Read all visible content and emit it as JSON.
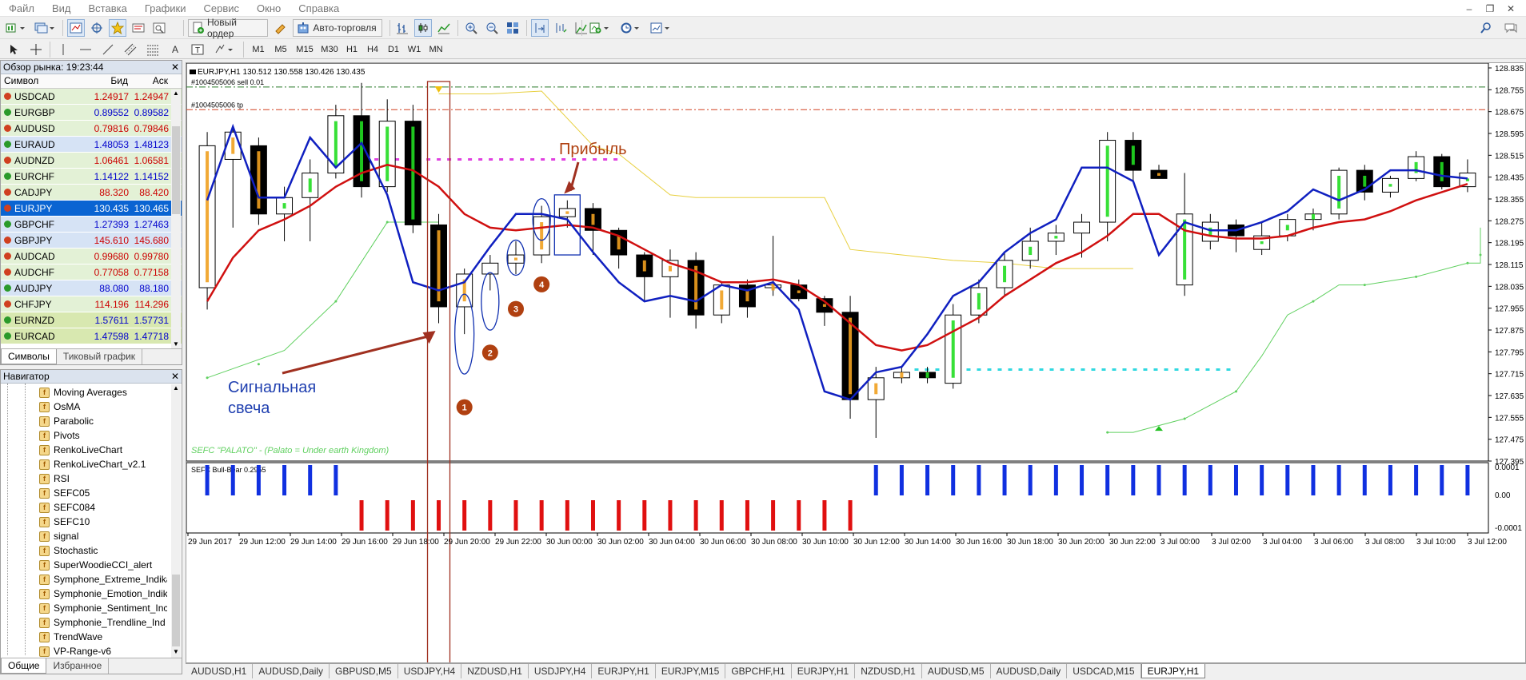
{
  "menu": [
    "Файл",
    "Вид",
    "Вставка",
    "Графики",
    "Сервис",
    "Окно",
    "Справка"
  ],
  "toolbar": {
    "new_order": "Новый ордер",
    "auto_trading": "Авто-торговля"
  },
  "timeframes": [
    "M1",
    "M5",
    "M15",
    "M30",
    "H1",
    "H4",
    "D1",
    "W1",
    "MN"
  ],
  "market_watch": {
    "title": "Обзор рынка: 19:23:44",
    "col_symbol": "Символ",
    "col_bid": "Бид",
    "col_ask": "Аск",
    "rows": [
      {
        "s": "USDCAD",
        "b": "1.24917",
        "a": "1.24947",
        "bg": "#e3f1d6",
        "dir": "dn"
      },
      {
        "s": "EURGBP",
        "b": "0.89552",
        "a": "0.89582",
        "bg": "#e3f1d6",
        "dir": "up"
      },
      {
        "s": "AUDUSD",
        "b": "0.79816",
        "a": "0.79846",
        "bg": "#e3f1d6",
        "dir": "dn"
      },
      {
        "s": "EURAUD",
        "b": "1.48053",
        "a": "1.48123",
        "bg": "#d6e3f5",
        "dir": "up"
      },
      {
        "s": "AUDNZD",
        "b": "1.06461",
        "a": "1.06581",
        "bg": "#e3f1d6",
        "dir": "dn"
      },
      {
        "s": "EURCHF",
        "b": "1.14122",
        "a": "1.14152",
        "bg": "#e3f1d6",
        "dir": "up"
      },
      {
        "s": "CADJPY",
        "b": "88.320",
        "a": "88.420",
        "bg": "#e3f1d6",
        "dir": "dn"
      },
      {
        "s": "EURJPY",
        "b": "130.435",
        "a": "130.465",
        "bg": "#0a64d2",
        "dir": "dn",
        "sel": true
      },
      {
        "s": "GBPCHF",
        "b": "1.27393",
        "a": "1.27463",
        "bg": "#d6e3f5",
        "dir": "up"
      },
      {
        "s": "GBPJPY",
        "b": "145.610",
        "a": "145.680",
        "bg": "#d6e3f5",
        "dir": "dn"
      },
      {
        "s": "AUDCAD",
        "b": "0.99680",
        "a": "0.99780",
        "bg": "#e3f1d6",
        "dir": "dn"
      },
      {
        "s": "AUDCHF",
        "b": "0.77058",
        "a": "0.77158",
        "bg": "#e3f1d6",
        "dir": "dn"
      },
      {
        "s": "AUDJPY",
        "b": "88.080",
        "a": "88.180",
        "bg": "#d6e3f5",
        "dir": "up"
      },
      {
        "s": "CHFJPY",
        "b": "114.196",
        "a": "114.296",
        "bg": "#e3f1d6",
        "dir": "dn"
      },
      {
        "s": "EURNZD",
        "b": "1.57611",
        "a": "1.57731",
        "bg": "#d8e8b0",
        "dir": "up"
      },
      {
        "s": "EURCAD",
        "b": "1.47598",
        "a": "1.47718",
        "bg": "#d8e8b0",
        "dir": "up"
      }
    ],
    "tabs": [
      "Символы",
      "Тиковый график"
    ]
  },
  "navigator": {
    "title": "Навигатор",
    "items": [
      "Moving Averages",
      "OsMA",
      "Parabolic",
      "Pivots",
      "RenkoLiveChart",
      "RenkoLiveChart_v2.1",
      "RSI",
      "SEFC05",
      "SEFC084",
      "SEFC10",
      "signal",
      "Stochastic",
      "SuperWoodieCCI_alert",
      "Symphone_Extreme_Indika",
      "Symphonie_Emotion_Indik",
      "Symphonie_Sentiment_Inc",
      "Symphonie_Trendline_Ind",
      "TrendWave",
      "VP-Range-v6"
    ],
    "tabs": [
      "Общие",
      "Избранное"
    ]
  },
  "chart": {
    "header": "EURJPY,H1  130.512 130.558 130.426 130.435",
    "order_line": "#1004505006 sell 0.01",
    "tp_line": "#1004505006 tp",
    "indicator_text": "SEFC \"PALATO\" - (Palato = Under earth Kingdom)",
    "sub_label": "SEFC Bull-Bear 0.2955",
    "annotation_profit": "Прибыль",
    "annotation_signal_1": "Сигнальная",
    "annotation_signal_2": "свеча",
    "markers": [
      "1",
      "2",
      "3",
      "4"
    ],
    "price_labels": [
      "128.835",
      "128.755",
      "128.675",
      "128.595",
      "128.515",
      "128.435",
      "128.355",
      "128.275",
      "128.195",
      "128.115",
      "128.035",
      "127.955",
      "127.875",
      "127.795",
      "127.715",
      "127.635",
      "127.555",
      "127.475",
      "127.395"
    ],
    "sub_price_labels": [
      "0.0001",
      "0.00",
      "-0.0001"
    ],
    "time_labels": [
      "29 Jun 2017",
      "29 Jun 12:00",
      "29 Jun 14:00",
      "29 Jun 16:00",
      "29 Jun 18:00",
      "29 Jun 20:00",
      "29 Jun 22:00",
      "30 Jun 00:00",
      "30 Jun 02:00",
      "30 Jun 04:00",
      "30 Jun 06:00",
      "30 Jun 08:00",
      "30 Jun 10:00",
      "30 Jun 12:00",
      "30 Jun 14:00",
      "30 Jun 16:00",
      "30 Jun 18:00",
      "30 Jun 20:00",
      "30 Jun 22:00",
      "3 Jul 00:00",
      "3 Jul 02:00",
      "3 Jul 04:00",
      "3 Jul 06:00",
      "3 Jul 08:00",
      "3 Jul 10:00",
      "3 Jul 12:00"
    ]
  },
  "bottom_tabs": [
    "AUDUSD,H1",
    "AUDUSD,Daily",
    "GBPUSD,M5",
    "USDJPY,H4",
    "NZDUSD,H1",
    "USDJPY,H4",
    "EURJPY,H1",
    "EURJPY,M15",
    "GBPCHF,H1",
    "EURJPY,H1",
    "NZDUSD,H1",
    "AUDUSD,M5",
    "AUDUSD,Daily",
    "USDCAD,M15",
    "EURJPY,H1"
  ],
  "bottom_tab_active": 14,
  "chart_data": {
    "type": "candlestick",
    "symbol": "EURJPY",
    "timeframe": "H1",
    "ylim": [
      127.395,
      128.835
    ],
    "candles": [
      {
        "o": 128.03,
        "h": 128.6,
        "l": 127.95,
        "c": 128.55
      },
      {
        "o": 128.5,
        "h": 128.62,
        "l": 128.25,
        "c": 128.6
      },
      {
        "o": 128.55,
        "h": 128.58,
        "l": 128.26,
        "c": 128.3
      },
      {
        "o": 128.3,
        "h": 128.4,
        "l": 128.2,
        "c": 128.36
      },
      {
        "o": 128.36,
        "h": 128.5,
        "l": 128.2,
        "c": 128.45
      },
      {
        "o": 128.45,
        "h": 128.7,
        "l": 128.43,
        "c": 128.66
      },
      {
        "o": 128.66,
        "h": 128.78,
        "l": 128.36,
        "c": 128.4
      },
      {
        "o": 128.4,
        "h": 128.72,
        "l": 128.38,
        "c": 128.64
      },
      {
        "o": 128.64,
        "h": 128.7,
        "l": 128.23,
        "c": 128.26
      },
      {
        "o": 128.26,
        "h": 128.3,
        "l": 127.9,
        "c": 127.96
      },
      {
        "o": 127.96,
        "h": 128.1,
        "l": 127.86,
        "c": 128.08
      },
      {
        "o": 128.08,
        "h": 128.15,
        "l": 128.02,
        "c": 128.12
      },
      {
        "o": 128.12,
        "h": 128.2,
        "l": 128.08,
        "c": 128.15
      },
      {
        "o": 128.15,
        "h": 128.33,
        "l": 128.12,
        "c": 128.29
      },
      {
        "o": 128.29,
        "h": 128.35,
        "l": 128.25,
        "c": 128.32
      },
      {
        "o": 128.32,
        "h": 128.34,
        "l": 128.15,
        "c": 128.24
      },
      {
        "o": 128.24,
        "h": 128.25,
        "l": 128.1,
        "c": 128.15
      },
      {
        "o": 128.15,
        "h": 128.16,
        "l": 127.98,
        "c": 128.07
      },
      {
        "o": 128.07,
        "h": 128.17,
        "l": 127.92,
        "c": 128.13
      },
      {
        "o": 128.13,
        "h": 128.16,
        "l": 127.88,
        "c": 127.93
      },
      {
        "o": 127.93,
        "h": 128.05,
        "l": 127.9,
        "c": 128.04
      },
      {
        "o": 128.04,
        "h": 128.06,
        "l": 127.92,
        "c": 127.96
      },
      {
        "o": 128.03,
        "h": 128.22,
        "l": 128.0,
        "c": 128.04
      },
      {
        "o": 128.04,
        "h": 128.06,
        "l": 127.98,
        "c": 127.99
      },
      {
        "o": 127.99,
        "h": 128.0,
        "l": 127.89,
        "c": 127.94
      },
      {
        "o": 127.94,
        "h": 128.0,
        "l": 127.55,
        "c": 127.62
      },
      {
        "o": 127.62,
        "h": 127.74,
        "l": 127.48,
        "c": 127.7
      },
      {
        "o": 127.7,
        "h": 127.74,
        "l": 127.68,
        "c": 127.72
      },
      {
        "o": 127.72,
        "h": 127.74,
        "l": 127.68,
        "c": 127.7
      },
      {
        "o": 127.68,
        "h": 127.97,
        "l": 127.66,
        "c": 127.93
      },
      {
        "o": 127.93,
        "h": 128.06,
        "l": 127.9,
        "c": 128.03
      },
      {
        "o": 128.03,
        "h": 128.16,
        "l": 128.0,
        "c": 128.13
      },
      {
        "o": 128.13,
        "h": 128.25,
        "l": 128.1,
        "c": 128.2
      },
      {
        "o": 128.2,
        "h": 128.26,
        "l": 128.15,
        "c": 128.23
      },
      {
        "o": 128.23,
        "h": 128.3,
        "l": 128.14,
        "c": 128.27
      },
      {
        "o": 128.27,
        "h": 128.6,
        "l": 128.2,
        "c": 128.57
      },
      {
        "o": 128.57,
        "h": 128.6,
        "l": 128.42,
        "c": 128.46
      },
      {
        "o": 128.46,
        "h": 128.48,
        "l": 128.43,
        "c": 128.43
      },
      {
        "o": 128.04,
        "h": 128.45,
        "l": 128.0,
        "c": 128.3
      },
      {
        "o": 128.2,
        "h": 128.3,
        "l": 128.17,
        "c": 128.27
      },
      {
        "o": 128.26,
        "h": 128.28,
        "l": 128.16,
        "c": 128.22
      },
      {
        "o": 128.17,
        "h": 128.27,
        "l": 128.15,
        "c": 128.22
      },
      {
        "o": 128.22,
        "h": 128.3,
        "l": 128.2,
        "c": 128.28
      },
      {
        "o": 128.28,
        "h": 128.32,
        "l": 128.24,
        "c": 128.3
      },
      {
        "o": 128.3,
        "h": 128.47,
        "l": 128.28,
        "c": 128.46
      },
      {
        "o": 128.46,
        "h": 128.48,
        "l": 128.35,
        "c": 128.38
      },
      {
        "o": 128.38,
        "h": 128.44,
        "l": 128.36,
        "c": 128.43
      },
      {
        "o": 128.43,
        "h": 128.53,
        "l": 128.42,
        "c": 128.51
      },
      {
        "o": 128.51,
        "h": 128.52,
        "l": 128.39,
        "c": 128.4
      },
      {
        "o": 128.4,
        "h": 128.5,
        "l": 128.38,
        "c": 128.45
      }
    ],
    "series": [
      {
        "name": "",
        "color": "#cc0000"
      },
      {
        "name": "",
        "color": "#0000cc"
      }
    ]
  }
}
